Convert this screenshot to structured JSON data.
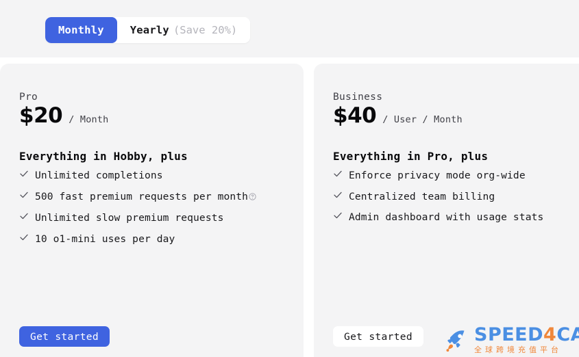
{
  "theme": {
    "accent": "#3f63e0",
    "page_bg": "#ffffff",
    "card_bg": "#f4f4f5",
    "text": "#18181b",
    "muted": "#b4b4bb",
    "watermark_blue": "#4b8fe3",
    "watermark_orange": "#f0873a"
  },
  "billing_toggle": {
    "monthly_label": "Monthly",
    "yearly_label": "Yearly",
    "yearly_note": "(Save 20%)",
    "selected": "Monthly"
  },
  "plans": [
    {
      "name": "Pro",
      "price": "$20",
      "unit": "/ Month",
      "tagline": "Everything in Hobby, plus",
      "features": [
        {
          "text": "Unlimited completions",
          "info": false
        },
        {
          "text": "500 fast premium requests per month",
          "info": true
        },
        {
          "text": "Unlimited slow premium requests",
          "info": false
        },
        {
          "text": "10 o1-mini uses per day",
          "info": false
        }
      ],
      "cta_label": "Get started",
      "cta_style": "primary"
    },
    {
      "name": "Business",
      "price": "$40",
      "unit": "/ User / Month",
      "tagline": "Everything in Pro, plus",
      "features": [
        {
          "text": "Enforce privacy mode org-wide",
          "info": false
        },
        {
          "text": "Centralized team billing",
          "info": false
        },
        {
          "text": "Admin dashboard with usage stats",
          "info": false
        }
      ],
      "cta_label": "Get started",
      "cta_style": "secondary"
    }
  ],
  "watermark": {
    "brand_part1": "SPEED",
    "brand_four": "4",
    "brand_part2": "CARD",
    "subtitle": "全球跨境充值平台"
  }
}
